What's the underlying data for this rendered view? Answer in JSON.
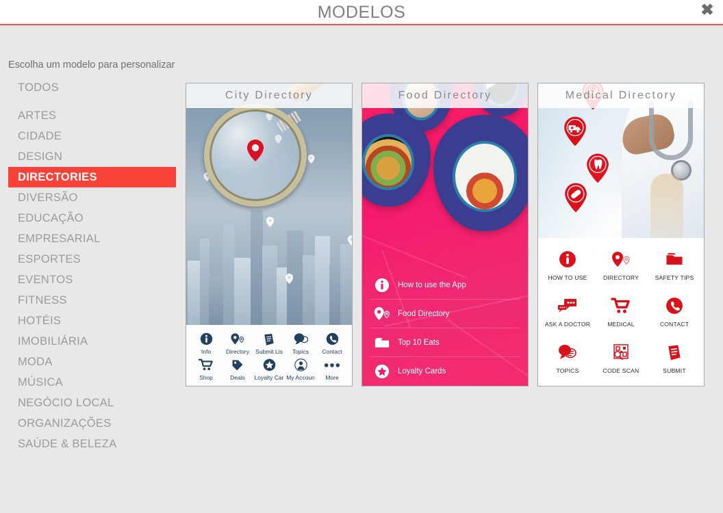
{
  "window": {
    "title": "MODELOS",
    "close_icon": "close-icon",
    "accent_color": "#ef5350"
  },
  "subtitle": "Escolha um modelo para personalizar",
  "sidebar": {
    "active_color": "#f9423a",
    "items": [
      {
        "label": "TODOS",
        "active": false
      },
      {
        "label": "ARTES",
        "active": false
      },
      {
        "label": "CIDADE",
        "active": false
      },
      {
        "label": "DESIGN",
        "active": false
      },
      {
        "label": "DIRECTORIES",
        "active": true
      },
      {
        "label": "DIVERSÃO",
        "active": false
      },
      {
        "label": "EDUCAÇÃO",
        "active": false
      },
      {
        "label": "EMPRESARIAL",
        "active": false
      },
      {
        "label": "ESPORTES",
        "active": false
      },
      {
        "label": "EVENTOS",
        "active": false
      },
      {
        "label": "FITNESS",
        "active": false
      },
      {
        "label": "HOTÉIS",
        "active": false
      },
      {
        "label": "IMOBILIÁRIA",
        "active": false
      },
      {
        "label": "MODA",
        "active": false
      },
      {
        "label": "MÚSICA",
        "active": false
      },
      {
        "label": "NEGÓCIO LOCAL",
        "active": false
      },
      {
        "label": "ORGANIZAÇÕES",
        "active": false
      },
      {
        "label": "SAÚDE & BELEZA",
        "active": false
      }
    ]
  },
  "templates": [
    {
      "id": "city-directory",
      "title": "City Directory",
      "theme_color": "#22405f",
      "menu": [
        {
          "label": "Info",
          "icon": "info-icon"
        },
        {
          "label": "Directory",
          "icon": "map-pin-icon"
        },
        {
          "label": "Submit Lis",
          "icon": "document-icon"
        },
        {
          "label": "Topics",
          "icon": "chat-bubble-icon"
        },
        {
          "label": "Contact",
          "icon": "phone-icon"
        },
        {
          "label": "Shop",
          "icon": "shopping-cart-icon"
        },
        {
          "label": "Deals",
          "icon": "tag-icon"
        },
        {
          "label": "Loyalty Car",
          "icon": "star-icon"
        },
        {
          "label": "My Accoun",
          "icon": "user-icon"
        },
        {
          "label": "More",
          "icon": "more-dots-icon"
        }
      ]
    },
    {
      "id": "food-directory",
      "title": "Food Directory",
      "theme_color": "#fa1d63",
      "menu": [
        {
          "label": "How to use the App",
          "icon": "info-icon"
        },
        {
          "label": "Food Directory",
          "icon": "map-pin-icon"
        },
        {
          "label": "Top 10 Eats",
          "icon": "folder-icon"
        },
        {
          "label": "Loyalty Cards",
          "icon": "star-icon"
        }
      ]
    },
    {
      "id": "medical-directory",
      "title": "Medical Directory",
      "theme_color": "#d9111b",
      "menu": [
        {
          "label": "HOW TO USE",
          "icon": "info-icon"
        },
        {
          "label": "DIRECTORY",
          "icon": "map-pin-icon"
        },
        {
          "label": "SAFETY TIPS",
          "icon": "folder-icon"
        },
        {
          "label": "ASK A DOCTOR",
          "icon": "chat-bubbles-icon"
        },
        {
          "label": "MEDICAL",
          "icon": "shopping-cart-icon"
        },
        {
          "label": "CONTACT",
          "icon": "phone-icon"
        },
        {
          "label": "TOPICS",
          "icon": "chat-bubble-icon"
        },
        {
          "label": "CODE SCAN",
          "icon": "qr-scan-icon"
        },
        {
          "label": "SUBMIT",
          "icon": "document-icon"
        }
      ]
    }
  ]
}
